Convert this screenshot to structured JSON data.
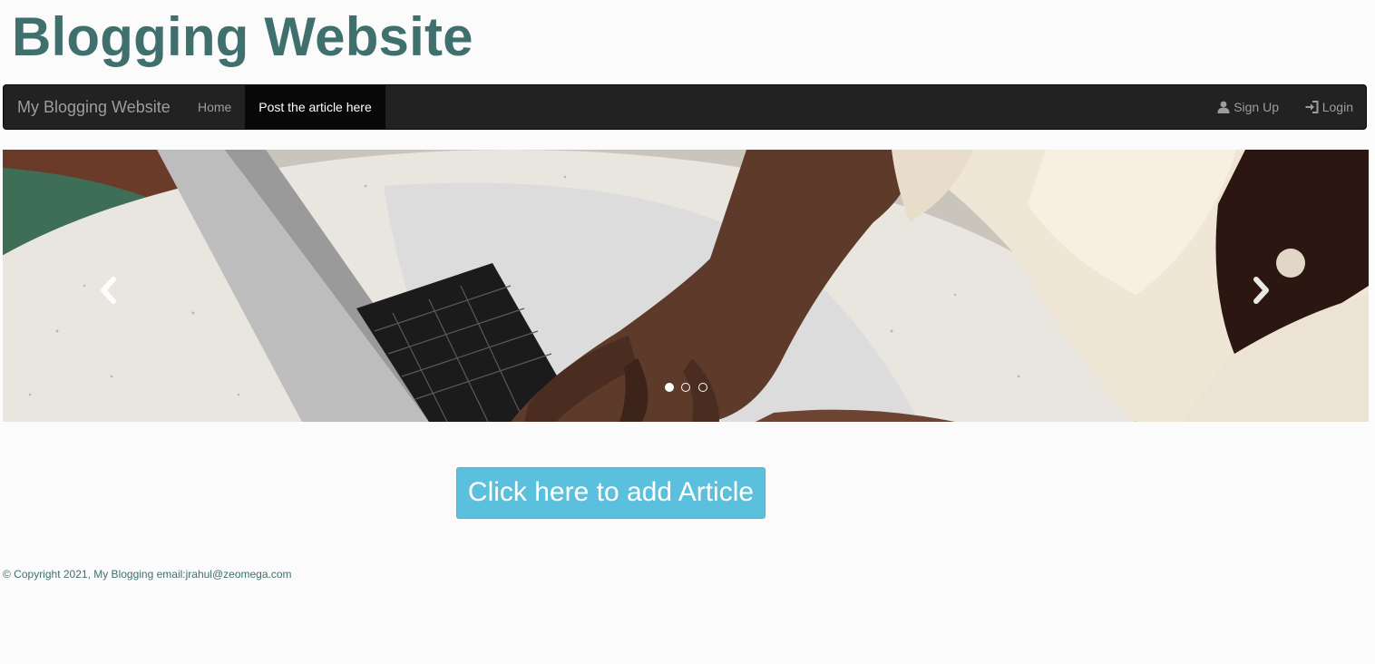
{
  "header": {
    "title": "Blogging Website"
  },
  "navbar": {
    "brand": "My Blogging Website",
    "items": [
      {
        "label": "Home"
      },
      {
        "label": "Post the article here",
        "active": true
      }
    ],
    "right_items": [
      {
        "label": "Sign Up",
        "icon": "user-icon"
      },
      {
        "label": "Login",
        "icon": "login-icon"
      }
    ],
    "bg_color": "#222222"
  },
  "carousel": {
    "slide_count": 3,
    "active_index": 0,
    "prev_icon": "chevron-left-icon",
    "next_icon": "chevron-right-icon"
  },
  "main": {
    "add_button_label": "Click here to add Article",
    "add_button_color": "#5bc0de"
  },
  "footer": {
    "text": "© Copyright 2021, My Blogging email:jrahul@zeomega.com"
  },
  "colors": {
    "title": "#3f706d",
    "page_bg": "#fbfbfb"
  }
}
